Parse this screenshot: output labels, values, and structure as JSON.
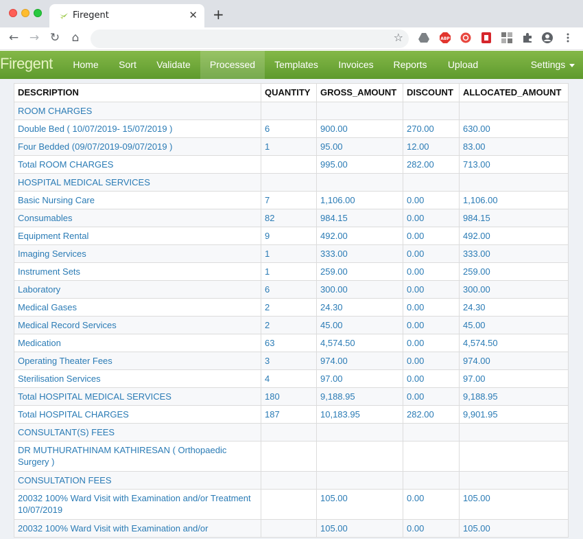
{
  "browser": {
    "tab_title": "Firegent",
    "tab_close": "✕",
    "new_tab": "+",
    "url": ""
  },
  "app": {
    "brand": "Firegent",
    "nav": [
      {
        "label": "Home",
        "active": false
      },
      {
        "label": "Sort",
        "active": false
      },
      {
        "label": "Validate",
        "active": false
      },
      {
        "label": "Processed",
        "active": true
      },
      {
        "label": "Templates",
        "active": false
      },
      {
        "label": "Invoices",
        "active": false
      },
      {
        "label": "Reports",
        "active": false
      },
      {
        "label": "Upload",
        "active": false
      }
    ],
    "settings_label": "Settings"
  },
  "table": {
    "headers": [
      "DESCRIPTION",
      "QUANTITY",
      "GROSS_AMOUNT",
      "DISCOUNT",
      "ALLOCATED_AMOUNT"
    ],
    "rows": [
      [
        "ROOM CHARGES",
        "",
        "",
        "",
        ""
      ],
      [
        "Double Bed ( 10/07/2019- 15/07/2019 )",
        "6",
        "900.00",
        "270.00",
        "630.00"
      ],
      [
        "Four Bedded (09/07/2019-09/07/2019 )",
        "1",
        "95.00",
        "12.00",
        "83.00"
      ],
      [
        "Total ROOM CHARGES",
        "",
        "995.00",
        "282.00",
        "713.00"
      ],
      [
        "HOSPITAL MEDICAL SERVICES",
        "",
        "",
        "",
        ""
      ],
      [
        "Basic Nursing Care",
        "7",
        "1,106.00",
        "0.00",
        "1,106.00"
      ],
      [
        "Consumables",
        "82",
        "984.15",
        "0.00",
        "984.15"
      ],
      [
        "Equipment Rental",
        "9",
        "492.00",
        "0.00",
        "492.00"
      ],
      [
        "Imaging Services",
        "1",
        "333.00",
        "0.00",
        "333.00"
      ],
      [
        "Instrument Sets",
        "1",
        "259.00",
        "0.00",
        "259.00"
      ],
      [
        "Laboratory",
        "6",
        "300.00",
        "0.00",
        "300.00"
      ],
      [
        "Medical Gases",
        "2",
        "24.30",
        "0.00",
        "24.30"
      ],
      [
        "Medical Record Services",
        "2",
        "45.00",
        "0.00",
        "45.00"
      ],
      [
        "Medication",
        "63",
        "4,574.50",
        "0.00",
        "4,574.50"
      ],
      [
        "Operating Theater Fees",
        "3",
        "974.00",
        "0.00",
        "974.00"
      ],
      [
        "Sterilisation Services",
        "4",
        "97.00",
        "0.00",
        "97.00"
      ],
      [
        "Total HOSPITAL MEDICAL SERVICES",
        "180",
        "9,188.95",
        "0.00",
        "9,188.95"
      ],
      [
        "Total HOSPITAL CHARGES",
        "187",
        "10,183.95",
        "282.00",
        "9,901.95"
      ],
      [
        "CONSULTANT(S) FEES",
        "",
        "",
        "",
        ""
      ],
      [
        "DR MUTHURATHINAM KATHIRESAN ( Orthopaedic Surgery )",
        "",
        "",
        "",
        ""
      ],
      [
        "CONSULTATION FEES",
        "",
        "",
        "",
        ""
      ],
      [
        "20032 100% Ward Visit with Examination and/or Treatment 10/07/2019",
        "",
        "105.00",
        "0.00",
        "105.00"
      ],
      [
        "20032 100% Ward Visit with Examination and/or",
        "",
        "105.00",
        "0.00",
        "105.00"
      ]
    ]
  }
}
